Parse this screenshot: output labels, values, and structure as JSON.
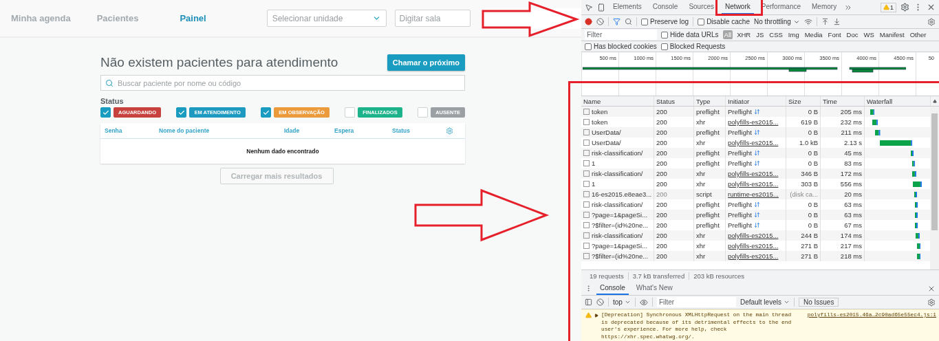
{
  "app": {
    "nav": [
      {
        "label": "Minha agenda",
        "selected": false
      },
      {
        "label": "Pacientes",
        "selected": false
      },
      {
        "label": "Painel",
        "selected": true
      }
    ],
    "unit_select": {
      "placeholder": "Selecionar unidade"
    },
    "room_field": {
      "placeholder": "Digitar sala"
    },
    "heading": "Não existem pacientes para atendimento",
    "call_button": "Chamar o próximo",
    "search": {
      "placeholder": "Buscar paciente por nome ou código"
    },
    "status_label": "Status",
    "filters": [
      {
        "label": "AGUARDANDO",
        "checked": true,
        "color": "#c8423d"
      },
      {
        "label": "EM ATENDIMENTO",
        "checked": true,
        "color": "#1e9ac0"
      },
      {
        "label": "EM OBSERVAÇÃO",
        "checked": true,
        "color": "#eb9a3c"
      },
      {
        "label": "FINALIZADOS",
        "checked": false,
        "color": "#1db38a"
      },
      {
        "label": "AUSENTE",
        "checked": false,
        "color": "#9aa0a3"
      }
    ],
    "table": {
      "columns": [
        "Senha",
        "Nome do paciente",
        "Idade",
        "Espera",
        "Status"
      ],
      "empty": "Nenhum dado encontrado"
    },
    "load_more": "Carregar mais resultados"
  },
  "devtools": {
    "tabs": [
      {
        "label": "Elements",
        "selected": false
      },
      {
        "label": "Console",
        "selected": false
      },
      {
        "label": "Sources",
        "selected": false
      },
      {
        "label": "Network",
        "selected": true
      },
      {
        "label": "Performance",
        "selected": false
      },
      {
        "label": "Memory",
        "selected": false
      }
    ],
    "warning_count": "1",
    "preserve_log": {
      "label": "Preserve log",
      "checked": false
    },
    "disable_cache": {
      "label": "Disable cache",
      "checked": false
    },
    "throttling": "No throttling",
    "filter": {
      "placeholder": "Filter"
    },
    "hide_data_urls": {
      "label": "Hide data URLs",
      "checked": false
    },
    "type_filters": [
      {
        "label": "All",
        "selected": true
      },
      {
        "label": "XHR",
        "selected": false
      },
      {
        "label": "JS",
        "selected": false
      },
      {
        "label": "CSS",
        "selected": false
      },
      {
        "label": "Img",
        "selected": false
      },
      {
        "label": "Media",
        "selected": false
      },
      {
        "label": "Font",
        "selected": false
      },
      {
        "label": "Doc",
        "selected": false
      },
      {
        "label": "WS",
        "selected": false
      },
      {
        "label": "Manifest",
        "selected": false
      },
      {
        "label": "Other",
        "selected": false
      }
    ],
    "blocked_cookies": {
      "label": "Has blocked cookies",
      "checked": false
    },
    "blocked_requests": {
      "label": "Blocked Requests",
      "checked": false
    },
    "timeline_ticks": [
      "500 ms",
      "1000 ms",
      "1500 ms",
      "2000 ms",
      "2500 ms",
      "3000 ms",
      "3500 ms",
      "4000 ms",
      "4500 ms",
      "50"
    ],
    "columns": [
      "Name",
      "Status",
      "Type",
      "Initiator",
      "Size",
      "Time",
      "Waterfall"
    ],
    "rows": [
      {
        "name": "token",
        "status": "200",
        "type": "preflight",
        "initiator": "Preflight",
        "kind": "preflight",
        "size": "0 B",
        "time": "205 ms",
        "from_cache": false
      },
      {
        "name": "token",
        "status": "200",
        "type": "xhr",
        "initiator": "polyfills-es2015...",
        "kind": "link",
        "size": "619 B",
        "time": "232 ms",
        "from_cache": false
      },
      {
        "name": "UserData/",
        "status": "200",
        "type": "preflight",
        "initiator": "Preflight",
        "kind": "preflight",
        "size": "0 B",
        "time": "211 ms",
        "from_cache": false
      },
      {
        "name": "UserData/",
        "status": "200",
        "type": "xhr",
        "initiator": "polyfills-es2015...",
        "kind": "link",
        "size": "1.0 kB",
        "time": "2.13 s",
        "from_cache": false
      },
      {
        "name": "risk-classification/",
        "status": "200",
        "type": "preflight",
        "initiator": "Preflight",
        "kind": "preflight",
        "size": "0 B",
        "time": "45 ms",
        "from_cache": false
      },
      {
        "name": "1",
        "status": "200",
        "type": "preflight",
        "initiator": "Preflight",
        "kind": "preflight",
        "size": "0 B",
        "time": "83 ms",
        "from_cache": false
      },
      {
        "name": "risk-classification/",
        "status": "200",
        "type": "xhr",
        "initiator": "polyfills-es2015...",
        "kind": "link",
        "size": "346 B",
        "time": "172 ms",
        "from_cache": false
      },
      {
        "name": "1",
        "status": "200",
        "type": "xhr",
        "initiator": "polyfills-es2015...",
        "kind": "link",
        "size": "303 B",
        "time": "556 ms",
        "from_cache": false
      },
      {
        "name": "16-es2015.e8eae3...",
        "status": "200",
        "type": "script",
        "initiator": "runtime-es2015...",
        "kind": "link",
        "size": "(disk ca...",
        "time": "20 ms",
        "from_cache": true
      },
      {
        "name": "risk-classification/",
        "status": "200",
        "type": "preflight",
        "initiator": "Preflight",
        "kind": "preflight",
        "size": "0 B",
        "time": "63 ms",
        "from_cache": false
      },
      {
        "name": "?page=1&pageSi...",
        "status": "200",
        "type": "preflight",
        "initiator": "Preflight",
        "kind": "preflight",
        "size": "0 B",
        "time": "63 ms",
        "from_cache": false
      },
      {
        "name": "?$filter=(id%20ne...",
        "status": "200",
        "type": "preflight",
        "initiator": "Preflight",
        "kind": "preflight",
        "size": "0 B",
        "time": "67 ms",
        "from_cache": false
      },
      {
        "name": "risk-classification/",
        "status": "200",
        "type": "xhr",
        "initiator": "polyfills-es2015...",
        "kind": "link",
        "size": "244 B",
        "time": "174 ms",
        "from_cache": false
      },
      {
        "name": "?page=1&pageSi...",
        "status": "200",
        "type": "xhr",
        "initiator": "polyfills-es2015...",
        "kind": "link",
        "size": "271 B",
        "time": "217 ms",
        "from_cache": false
      },
      {
        "name": "?$filter=(id%20ne...",
        "status": "200",
        "type": "xhr",
        "initiator": "polyfills-es2015...",
        "kind": "link",
        "size": "271 B",
        "time": "218 ms",
        "from_cache": false
      }
    ],
    "summary": [
      "19 requests",
      "3.7 kB transferred",
      "203 kB resources"
    ],
    "drawer_tabs": [
      {
        "label": "Console",
        "selected": true
      },
      {
        "label": "What's New",
        "selected": false
      }
    ],
    "context": "top",
    "console_filter": {
      "placeholder": "Filter"
    },
    "levels": "Default levels",
    "issues": "No Issues",
    "message": {
      "text": "[Deprecation] Synchronous XMLHttpRequest on the main thread is deprecated because of its detrimental effects to the end user's experience. For more help, check https://xhr.spec.whatwg.org/.",
      "source": "polyfills-es2015.46a…2c90ad65e55ec4.js:1"
    }
  }
}
